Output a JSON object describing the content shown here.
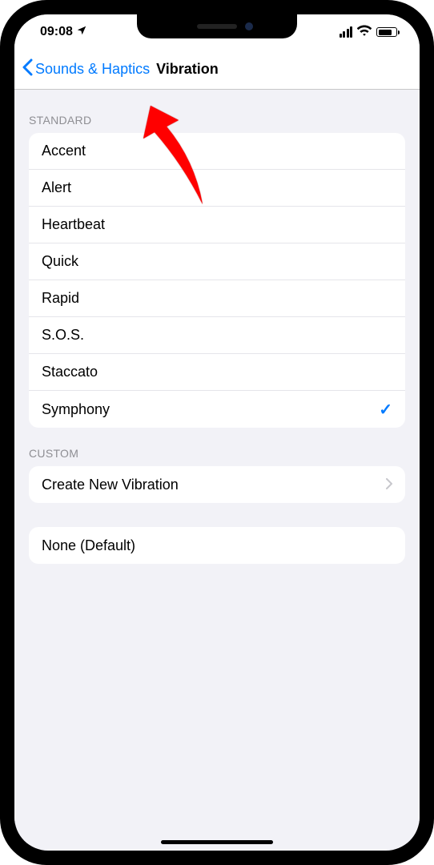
{
  "status": {
    "time": "09:08",
    "location_icon": "location-arrow-icon"
  },
  "nav": {
    "back_label": "Sounds & Haptics",
    "title": "Vibration"
  },
  "sections": {
    "standard": {
      "header": "STANDARD",
      "items": [
        {
          "label": "Accent",
          "selected": false
        },
        {
          "label": "Alert",
          "selected": false
        },
        {
          "label": "Heartbeat",
          "selected": false
        },
        {
          "label": "Quick",
          "selected": false
        },
        {
          "label": "Rapid",
          "selected": false
        },
        {
          "label": "S.O.S.",
          "selected": false
        },
        {
          "label": "Staccato",
          "selected": false
        },
        {
          "label": "Symphony",
          "selected": true
        }
      ]
    },
    "custom": {
      "header": "CUSTOM",
      "create_label": "Create New Vibration"
    },
    "none": {
      "label": "None (Default)"
    }
  }
}
